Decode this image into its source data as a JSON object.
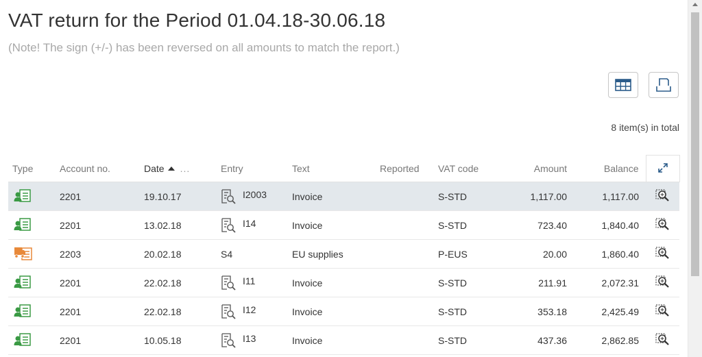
{
  "page": {
    "title": "VAT return for the Period 01.04.18-30.06.18",
    "note": "(Note! The sign (+/-) has been reversed on all amounts to match the report.)",
    "total": "8 item(s) in total"
  },
  "toolbar": {
    "table_view_icon": "table-grid-icon",
    "print_icon": "print-icon"
  },
  "columns": {
    "type": "Type",
    "account": "Account no.",
    "date": "Date",
    "date_more": "...",
    "entry": "Entry",
    "text": "Text",
    "reported": "Reported",
    "vat_code": "VAT code",
    "amount": "Amount",
    "balance": "Balance"
  },
  "rows": [
    {
      "type_icon": "customer-invoice-icon",
      "account": "2201",
      "date": "19.10.17",
      "entry": "I2003",
      "has_entry_icon": true,
      "text": "Invoice",
      "reported": "",
      "vat_code": "S-STD",
      "amount": "1,117.00",
      "balance": "1,117.00"
    },
    {
      "type_icon": "customer-invoice-icon",
      "account": "2201",
      "date": "13.02.18",
      "entry": "I14",
      "has_entry_icon": true,
      "text": "Invoice",
      "reported": "",
      "vat_code": "S-STD",
      "amount": "723.40",
      "balance": "1,840.40"
    },
    {
      "type_icon": "supplier-invoice-icon",
      "account": "2203",
      "date": "20.02.18",
      "entry": "S4",
      "has_entry_icon": false,
      "text": "EU supplies",
      "reported": "",
      "vat_code": "P-EUS",
      "amount": "20.00",
      "balance": "1,860.40"
    },
    {
      "type_icon": "customer-invoice-icon",
      "account": "2201",
      "date": "22.02.18",
      "entry": "I11",
      "has_entry_icon": true,
      "text": "Invoice",
      "reported": "",
      "vat_code": "S-STD",
      "amount": "211.91",
      "balance": "2,072.31"
    },
    {
      "type_icon": "customer-invoice-icon",
      "account": "2201",
      "date": "22.02.18",
      "entry": "I12",
      "has_entry_icon": true,
      "text": "Invoice",
      "reported": "",
      "vat_code": "S-STD",
      "amount": "353.18",
      "balance": "2,425.49"
    },
    {
      "type_icon": "customer-invoice-icon",
      "account": "2201",
      "date": "10.05.18",
      "entry": "I13",
      "has_entry_icon": true,
      "text": "Invoice",
      "reported": "",
      "vat_code": "S-STD",
      "amount": "437.36",
      "balance": "2,862.85"
    }
  ],
  "colors": {
    "selected_row": "#e3e8ec",
    "customer_icon": "#3a9a44",
    "supplier_icon": "#e8893a"
  }
}
